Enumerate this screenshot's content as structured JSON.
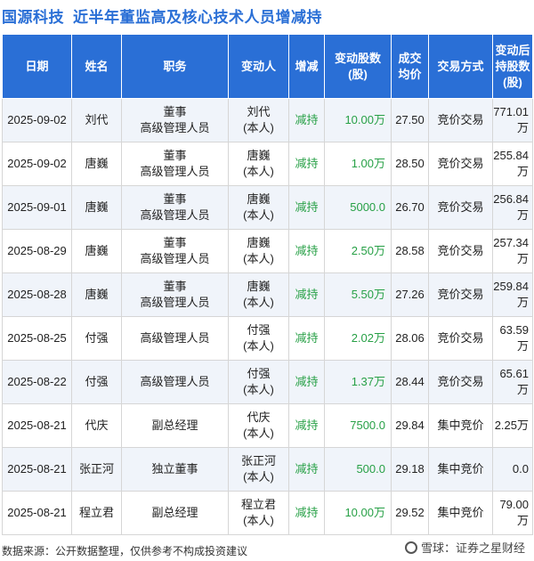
{
  "header": {
    "company": "国源科技",
    "title": "近半年董监高及核心技术人员增减持"
  },
  "columns": [
    "日期",
    "姓名",
    "职务",
    "变动人",
    "增减",
    "变动股数\n(股)",
    "成交\n均价",
    "交易方式",
    "变动后\n持股数\n(股)"
  ],
  "rows": [
    {
      "date": "2025-09-02",
      "name": "刘代",
      "role": "董事\n高级管理人员",
      "person": "刘代\n(本人)",
      "action": "减持",
      "amount": "10.00万",
      "price": "27.50",
      "method": "竞价交易",
      "held": "771.01万"
    },
    {
      "date": "2025-09-02",
      "name": "唐巍",
      "role": "董事\n高级管理人员",
      "person": "唐巍\n(本人)",
      "action": "减持",
      "amount": "1.00万",
      "price": "28.50",
      "method": "竞价交易",
      "held": "255.84万"
    },
    {
      "date": "2025-09-01",
      "name": "唐巍",
      "role": "董事\n高级管理人员",
      "person": "唐巍\n(本人)",
      "action": "减持",
      "amount": "5000.0",
      "price": "26.70",
      "method": "竞价交易",
      "held": "256.84万"
    },
    {
      "date": "2025-08-29",
      "name": "唐巍",
      "role": "董事\n高级管理人员",
      "person": "唐巍\n(本人)",
      "action": "减持",
      "amount": "2.50万",
      "price": "28.58",
      "method": "竞价交易",
      "held": "257.34万"
    },
    {
      "date": "2025-08-28",
      "name": "唐巍",
      "role": "董事\n高级管理人员",
      "person": "唐巍\n(本人)",
      "action": "减持",
      "amount": "5.50万",
      "price": "27.26",
      "method": "竞价交易",
      "held": "259.84万"
    },
    {
      "date": "2025-08-25",
      "name": "付强",
      "role": "高级管理人员",
      "person": "付强\n(本人)",
      "action": "减持",
      "amount": "2.02万",
      "price": "28.06",
      "method": "竞价交易",
      "held": "63.59万"
    },
    {
      "date": "2025-08-22",
      "name": "付强",
      "role": "高级管理人员",
      "person": "付强\n(本人)",
      "action": "减持",
      "amount": "1.37万",
      "price": "28.44",
      "method": "竞价交易",
      "held": "65.61万"
    },
    {
      "date": "2025-08-21",
      "name": "代庆",
      "role": "副总经理",
      "person": "代庆\n(本人)",
      "action": "减持",
      "amount": "7500.0",
      "price": "29.84",
      "method": "集中竞价",
      "held": "2.25万"
    },
    {
      "date": "2025-08-21",
      "name": "张正河",
      "role": "独立董事",
      "person": "张正河\n(本人)",
      "action": "减持",
      "amount": "500.0",
      "price": "29.18",
      "method": "集中竞价",
      "held": "0.0"
    },
    {
      "date": "2025-08-21",
      "name": "程立君",
      "role": "副总经理",
      "person": "程立君\n(本人)",
      "action": "减持",
      "amount": "10.00万",
      "price": "29.52",
      "method": "集中竞价",
      "held": "79.00万"
    }
  ],
  "footer": {
    "source": "数据来源：公开数据整理，仅供参考不构成投资建议",
    "brand": "雪球：证券之星财经"
  },
  "colors": {
    "header_bg": "#2a6fd6",
    "reduce_green": "#27a046",
    "stripe": "#f0f4fa"
  }
}
